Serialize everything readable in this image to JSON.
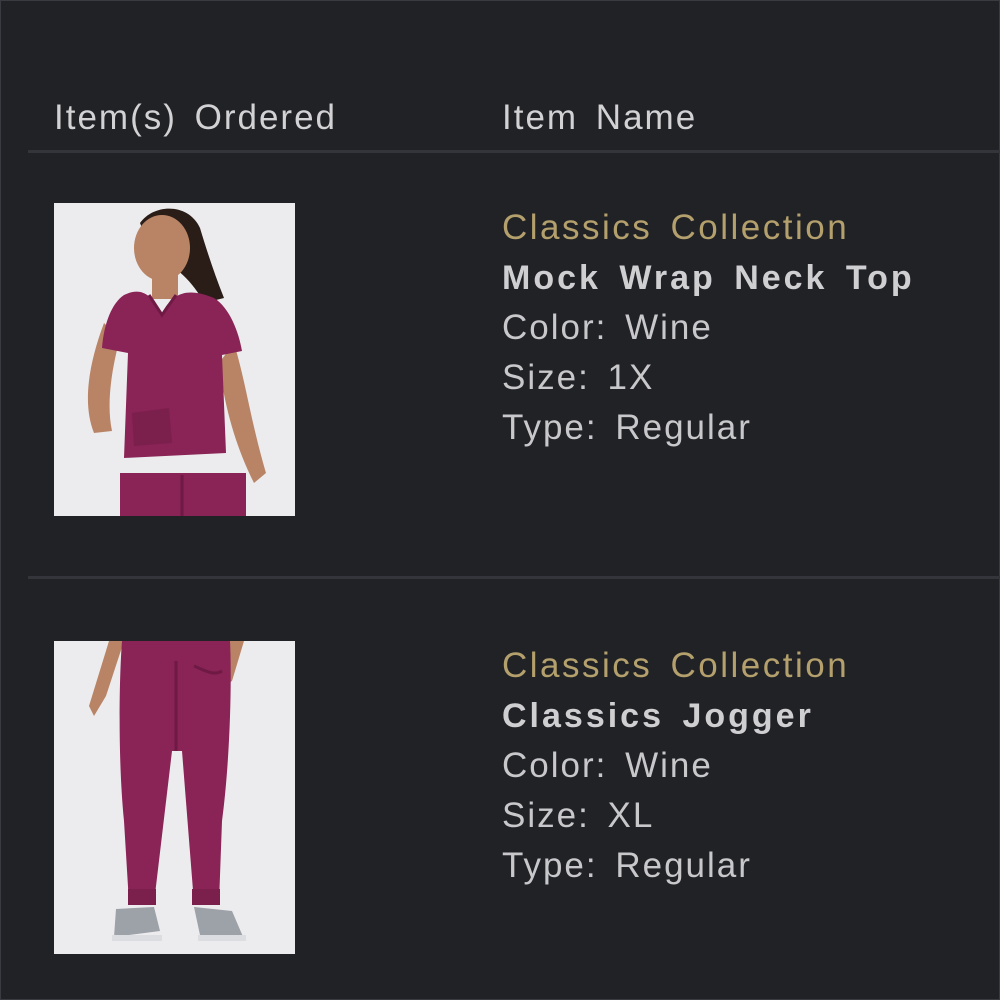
{
  "table": {
    "headers": {
      "items_ordered": "Item(s) Ordered",
      "item_name": "Item Name"
    }
  },
  "items": [
    {
      "collection": "Classics Collection",
      "name": "Mock Wrap Neck Top",
      "color": "Color: Wine",
      "size": "Size: 1X",
      "type": "Type: Regular",
      "image_icon": "scrub-top-photo"
    },
    {
      "collection": "Classics Collection",
      "name": "Classics Jogger",
      "color": "Color: Wine",
      "size": "Size: XL",
      "type": "Type: Regular",
      "image_icon": "jogger-pants-photo"
    }
  ],
  "colors": {
    "background": "#212226",
    "accent_gold": "#b4a06c",
    "product_wine": "#8a2356"
  }
}
